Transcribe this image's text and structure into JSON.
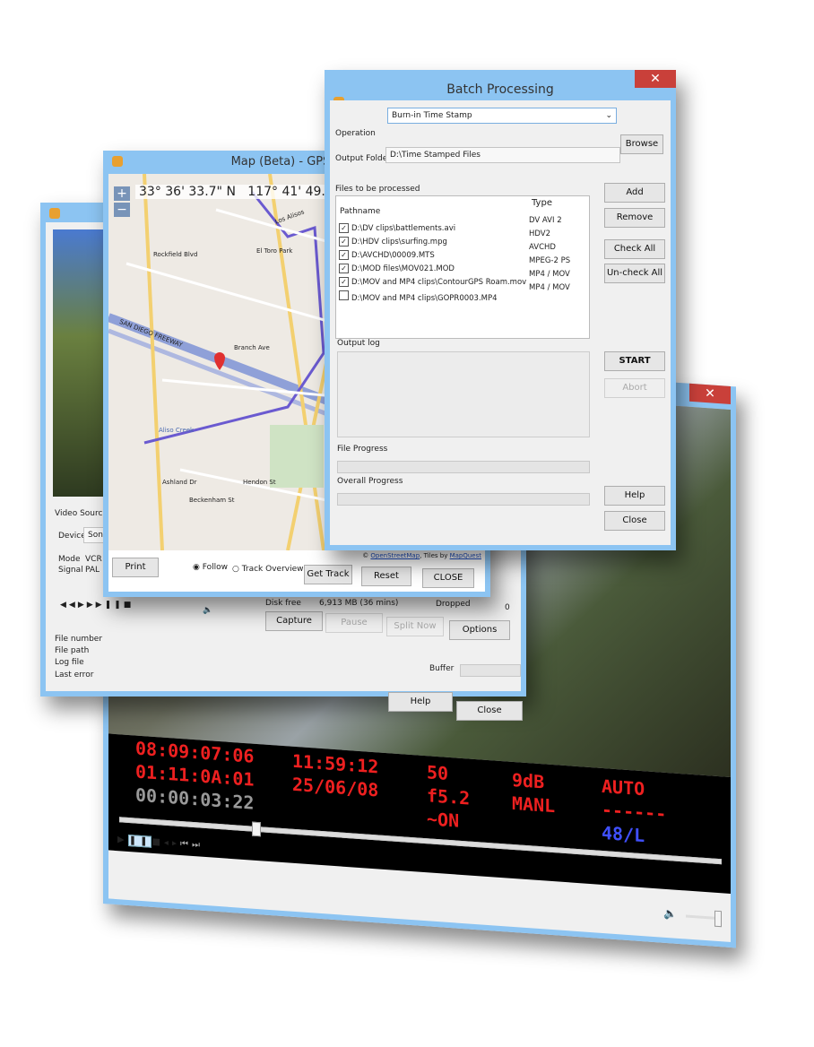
{
  "video_window": {
    "osd": {
      "col1": [
        "08:09:07:06",
        "01:11:0A:01",
        "00:00:03:22"
      ],
      "col2": [
        "11:59:12",
        "25/06/08"
      ],
      "col3": [
        "50",
        "f5.2",
        "~ON"
      ],
      "col4": [
        "9dB",
        "MANL"
      ],
      "col5": [
        "AUTO",
        "------",
        "48/L"
      ]
    },
    "colors": {
      "osd_red": "#ee2020",
      "osd_grey": "#999999",
      "osd_blue": "#4050ff"
    },
    "seek_position": 0.22,
    "volume_level": 1.0
  },
  "capture_window": {
    "video_source_label": "Video Source",
    "device_label": "Device",
    "device_value": "Sony",
    "mode_label": "Mode",
    "mode_value": "VCR",
    "signal_label": "Signal",
    "signal_value": "PAL",
    "disk_free_label": "Disk free",
    "disk_free_value": "6,913 MB (36 mins)",
    "dropped_label": "Dropped",
    "dropped_value": "0",
    "buttons": {
      "capture": "Capture",
      "pause": "Pause",
      "split_now": "Split Now",
      "options": "Options",
      "help": "Help",
      "close": "Close"
    },
    "info_labels": [
      "File number",
      "File path",
      "Log file",
      "Last error"
    ],
    "buffer_label": "Buffer"
  },
  "map_window": {
    "title": "Map (Beta) - GPS Tagging Test v",
    "latitude": "33° 36' 33.7\" N",
    "longitude": "117° 41' 49.2\"",
    "zoom_in": "+",
    "zoom_out": "−",
    "attribution_prefix": "©",
    "attribution_osm": "OpenStreetMap",
    "attribution_tiles": "Tiles by",
    "attribution_mq": "MapQuest",
    "street_labels": [
      "Rockfield Blvd",
      "SAN DIEGO FREEWAY",
      "Aliso Creek",
      "Los Alisos",
      "Hendon St",
      "Beckenham St",
      "Ashland Dr",
      "Branch Ave",
      "El Toro Park"
    ],
    "print_button": "Print",
    "follow_label": "Follow",
    "track_overview_label": "Track Overview",
    "follow_selected": true,
    "get_track_button": "Get Track",
    "reset_button": "Reset",
    "close_button": "CLOSE"
  },
  "batch_window": {
    "title": "Batch Processing",
    "close_glyph": "✕",
    "operation_label": "Operation",
    "operation_value": "Burn-in Time Stamp",
    "output_folder_label": "Output Folder",
    "output_folder_value": "D:\\Time Stamped Files",
    "browse_button": "Browse",
    "files_label": "Files to be processed",
    "columns": [
      "Pathname",
      "Type"
    ],
    "files": [
      {
        "path": "D:\\DV clips\\battlements.avi",
        "type": "DV AVI 2",
        "checked": true
      },
      {
        "path": "D:\\HDV clips\\surfing.mpg",
        "type": "HDV2",
        "checked": true
      },
      {
        "path": "D:\\AVCHD\\00009.MTS",
        "type": "AVCHD",
        "checked": true
      },
      {
        "path": "D:\\MOD files\\MOV021.MOD",
        "type": "MPEG-2 PS",
        "checked": true
      },
      {
        "path": "D:\\MOV and MP4 clips\\ContourGPS Roam.mov",
        "type": "MP4 / MOV",
        "checked": true
      },
      {
        "path": "D:\\MOV and MP4 clips\\GOPR0003.MP4",
        "type": "MP4 / MOV",
        "checked": false
      }
    ],
    "add_button": "Add",
    "remove_button": "Remove",
    "check_all_button": "Check All",
    "uncheck_all_button": "Un-check All",
    "output_log_label": "Output log",
    "start_button": "START",
    "abort_button": "Abort",
    "file_progress_label": "File Progress",
    "file_progress": 0,
    "overall_progress_label": "Overall Progress",
    "overall_progress": 0,
    "help_button": "Help",
    "close_button": "Close"
  }
}
